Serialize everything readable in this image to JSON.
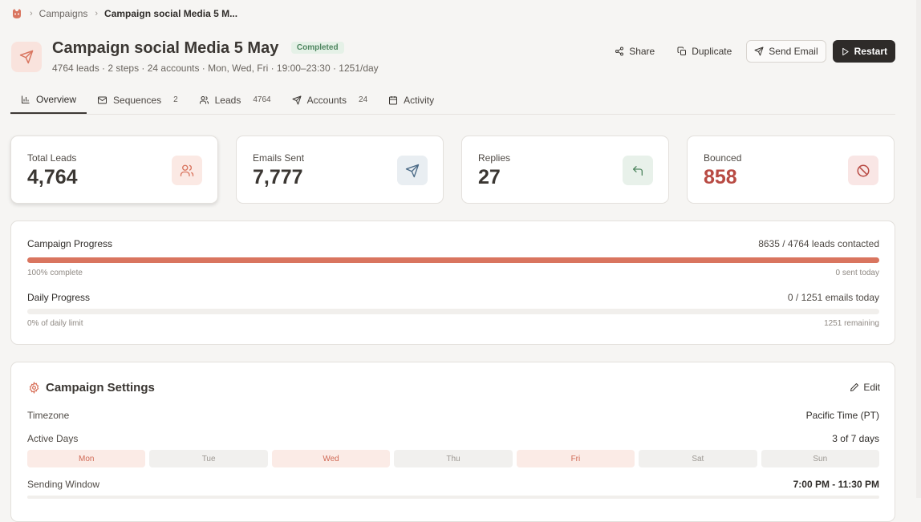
{
  "breadcrumb": {
    "items": [
      "Campaigns",
      "Campaign social Media 5 M..."
    ]
  },
  "header": {
    "title": "Campaign social Media 5 May",
    "status": "Completed",
    "subtitle": "4764 leads · 2 steps · 24 accounts · Mon, Wed, Fri · 19:00–23:30 · 1251/day",
    "actions": {
      "share": "Share",
      "duplicate": "Duplicate",
      "send_email": "Send Email",
      "restart": "Restart"
    }
  },
  "tabs": [
    {
      "label": "Overview",
      "count": "",
      "icon": "bar-chart-icon",
      "active": true
    },
    {
      "label": "Sequences",
      "count": "2",
      "icon": "mail-icon"
    },
    {
      "label": "Leads",
      "count": "4764",
      "icon": "users-icon"
    },
    {
      "label": "Accounts",
      "count": "24",
      "icon": "send-icon"
    },
    {
      "label": "Activity",
      "count": "",
      "icon": "calendar-icon"
    }
  ],
  "stats": [
    {
      "label": "Total Leads",
      "value": "4,764",
      "icon": "users-icon",
      "icon_bg": "#fbe9e4",
      "icon_color": "#d9755f"
    },
    {
      "label": "Emails Sent",
      "value": "7,777",
      "icon": "send-icon",
      "icon_bg": "#e9eef2",
      "icon_color": "#4b6a86"
    },
    {
      "label": "Replies",
      "value": "27",
      "icon": "reply-icon",
      "icon_bg": "#e8f1ea",
      "icon_color": "#4f8660"
    },
    {
      "label": "Bounced",
      "value": "858",
      "icon": "ban-icon",
      "icon_bg": "#f9e6e5",
      "icon_color": "#b84a43",
      "value_color": "#b84a43"
    }
  ],
  "progress": {
    "campaign": {
      "title": "Campaign Progress",
      "contacted": "8635 / 4764 leads contacted",
      "percent_label": "100% complete",
      "today": "0 sent today",
      "fill": 1.0
    },
    "daily": {
      "title": "Daily Progress",
      "today": "0 / 1251 emails today",
      "percent_label": "0% of daily limit",
      "remaining": "1251 remaining",
      "fill": 0.0
    }
  },
  "settings": {
    "title": "Campaign Settings",
    "edit": "Edit",
    "timezone": {
      "label": "Timezone",
      "value": "Pacific Time (PT)"
    },
    "active_days": {
      "label": "Active Days",
      "value": "3 of 7 days"
    },
    "days": [
      {
        "label": "Mon",
        "active": true
      },
      {
        "label": "Tue",
        "active": false
      },
      {
        "label": "Wed",
        "active": true
      },
      {
        "label": "Thu",
        "active": false
      },
      {
        "label": "Fri",
        "active": true
      },
      {
        "label": "Sat",
        "active": false
      },
      {
        "label": "Sun",
        "active": false
      }
    ],
    "sending_window": {
      "label": "Sending Window",
      "value": "7:00 PM - 11:30 PM"
    }
  },
  "colors": {
    "accent": "#d9755f",
    "success": "#4f8660",
    "danger": "#b84a43",
    "dark": "#2e2b29"
  }
}
